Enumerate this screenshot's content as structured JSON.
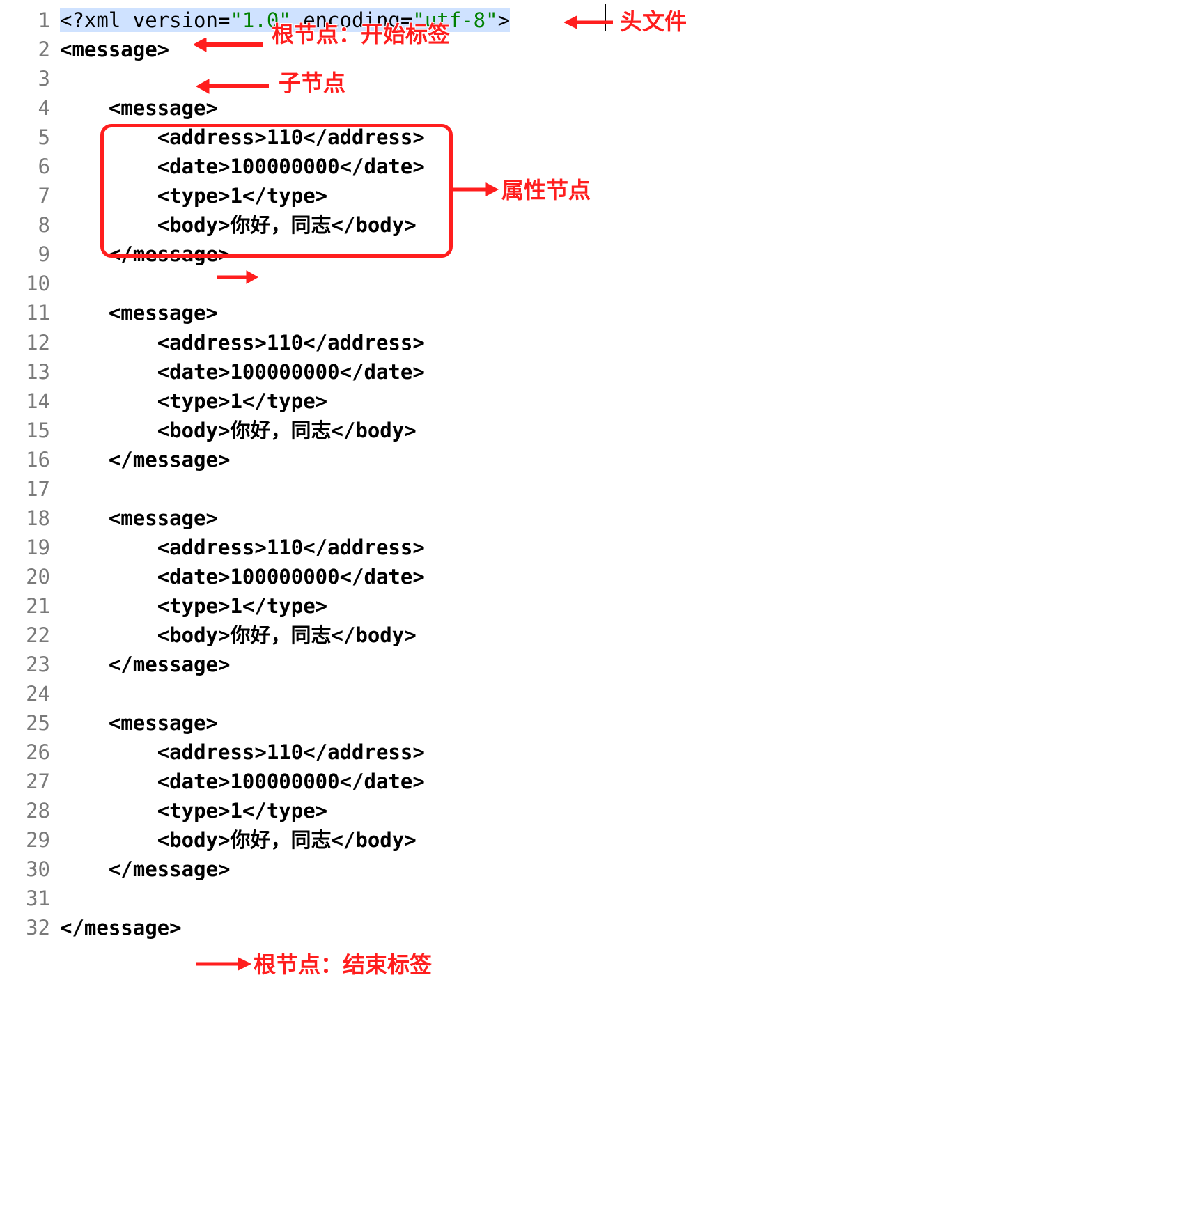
{
  "lines": [
    {
      "n": "1",
      "indent": 0,
      "segments": [
        {
          "c": "hl",
          "t": "<?xml version="
        },
        {
          "c": "hl str",
          "t": "\"1.0\""
        },
        {
          "c": "hl",
          "t": " encoding="
        },
        {
          "c": "hl str",
          "t": "\"utf-8\""
        },
        {
          "c": "hl",
          "t": ">"
        }
      ]
    },
    {
      "n": "2",
      "indent": 0,
      "segments": [
        {
          "c": "tag",
          "t": "<message>"
        }
      ]
    },
    {
      "n": "3",
      "indent": 0,
      "segments": []
    },
    {
      "n": "4",
      "indent": 1,
      "segments": [
        {
          "c": "tag",
          "t": "<message>"
        }
      ]
    },
    {
      "n": "5",
      "indent": 2,
      "segments": [
        {
          "c": "tag",
          "t": "<address>"
        },
        {
          "c": "txt",
          "t": "110"
        },
        {
          "c": "tag",
          "t": "</address>"
        }
      ]
    },
    {
      "n": "6",
      "indent": 2,
      "segments": [
        {
          "c": "tag",
          "t": "<date>"
        },
        {
          "c": "txt",
          "t": "100000000"
        },
        {
          "c": "tag",
          "t": "</date>"
        }
      ]
    },
    {
      "n": "7",
      "indent": 2,
      "segments": [
        {
          "c": "tag",
          "t": "<type>"
        },
        {
          "c": "txt",
          "t": "1"
        },
        {
          "c": "tag",
          "t": "</type>"
        }
      ]
    },
    {
      "n": "8",
      "indent": 2,
      "segments": [
        {
          "c": "tag",
          "t": "<body>"
        },
        {
          "c": "txt",
          "t": "你好，同志"
        },
        {
          "c": "tag",
          "t": "</body>"
        }
      ]
    },
    {
      "n": "9",
      "indent": 1,
      "segments": [
        {
          "c": "tag",
          "t": "</message>"
        }
      ]
    },
    {
      "n": "10",
      "indent": 0,
      "segments": []
    },
    {
      "n": "11",
      "indent": 1,
      "segments": [
        {
          "c": "tag",
          "t": "<message>"
        }
      ]
    },
    {
      "n": "12",
      "indent": 2,
      "segments": [
        {
          "c": "tag",
          "t": "<address>"
        },
        {
          "c": "txt",
          "t": "110"
        },
        {
          "c": "tag",
          "t": "</address>"
        }
      ]
    },
    {
      "n": "13",
      "indent": 2,
      "segments": [
        {
          "c": "tag",
          "t": "<date>"
        },
        {
          "c": "txt",
          "t": "100000000"
        },
        {
          "c": "tag",
          "t": "</date>"
        }
      ]
    },
    {
      "n": "14",
      "indent": 2,
      "segments": [
        {
          "c": "tag",
          "t": "<type>"
        },
        {
          "c": "txt",
          "t": "1"
        },
        {
          "c": "tag",
          "t": "</type>"
        }
      ]
    },
    {
      "n": "15",
      "indent": 2,
      "segments": [
        {
          "c": "tag",
          "t": "<body>"
        },
        {
          "c": "txt",
          "t": "你好，同志"
        },
        {
          "c": "tag",
          "t": "</body>"
        }
      ]
    },
    {
      "n": "16",
      "indent": 1,
      "segments": [
        {
          "c": "tag",
          "t": "</message>"
        }
      ]
    },
    {
      "n": "17",
      "indent": 0,
      "segments": []
    },
    {
      "n": "18",
      "indent": 1,
      "segments": [
        {
          "c": "tag",
          "t": "<message>"
        }
      ]
    },
    {
      "n": "19",
      "indent": 2,
      "segments": [
        {
          "c": "tag",
          "t": "<address>"
        },
        {
          "c": "txt",
          "t": "110"
        },
        {
          "c": "tag",
          "t": "</address>"
        }
      ]
    },
    {
      "n": "20",
      "indent": 2,
      "segments": [
        {
          "c": "tag",
          "t": "<date>"
        },
        {
          "c": "txt",
          "t": "100000000"
        },
        {
          "c": "tag",
          "t": "</date>"
        }
      ]
    },
    {
      "n": "21",
      "indent": 2,
      "segments": [
        {
          "c": "tag",
          "t": "<type>"
        },
        {
          "c": "txt",
          "t": "1"
        },
        {
          "c": "tag",
          "t": "</type>"
        }
      ]
    },
    {
      "n": "22",
      "indent": 2,
      "segments": [
        {
          "c": "tag",
          "t": "<body>"
        },
        {
          "c": "txt",
          "t": "你好，同志"
        },
        {
          "c": "tag",
          "t": "</body>"
        }
      ]
    },
    {
      "n": "23",
      "indent": 1,
      "segments": [
        {
          "c": "tag",
          "t": "</message>"
        }
      ]
    },
    {
      "n": "24",
      "indent": 0,
      "segments": []
    },
    {
      "n": "25",
      "indent": 1,
      "segments": [
        {
          "c": "tag",
          "t": "<message>"
        }
      ]
    },
    {
      "n": "26",
      "indent": 2,
      "segments": [
        {
          "c": "tag",
          "t": "<address>"
        },
        {
          "c": "txt",
          "t": "110"
        },
        {
          "c": "tag",
          "t": "</address>"
        }
      ]
    },
    {
      "n": "27",
      "indent": 2,
      "segments": [
        {
          "c": "tag",
          "t": "<date>"
        },
        {
          "c": "txt",
          "t": "100000000"
        },
        {
          "c": "tag",
          "t": "</date>"
        }
      ]
    },
    {
      "n": "28",
      "indent": 2,
      "segments": [
        {
          "c": "tag",
          "t": "<type>"
        },
        {
          "c": "txt",
          "t": "1"
        },
        {
          "c": "tag",
          "t": "</type>"
        }
      ]
    },
    {
      "n": "29",
      "indent": 2,
      "segments": [
        {
          "c": "tag",
          "t": "<body>"
        },
        {
          "c": "txt",
          "t": "你好，同志"
        },
        {
          "c": "tag",
          "t": "</body>"
        }
      ]
    },
    {
      "n": "30",
      "indent": 1,
      "segments": [
        {
          "c": "tag",
          "t": "</message>"
        }
      ]
    },
    {
      "n": "31",
      "indent": 0,
      "segments": []
    },
    {
      "n": "32",
      "indent": 0,
      "segments": [
        {
          "c": "tag",
          "t": "</message>"
        }
      ]
    }
  ],
  "labels": {
    "header_file": "头文件",
    "root_open": "根节点：开始标签",
    "child_node": "子节点",
    "attr_node": "属性节点",
    "root_close": "根节点：结束标签"
  }
}
